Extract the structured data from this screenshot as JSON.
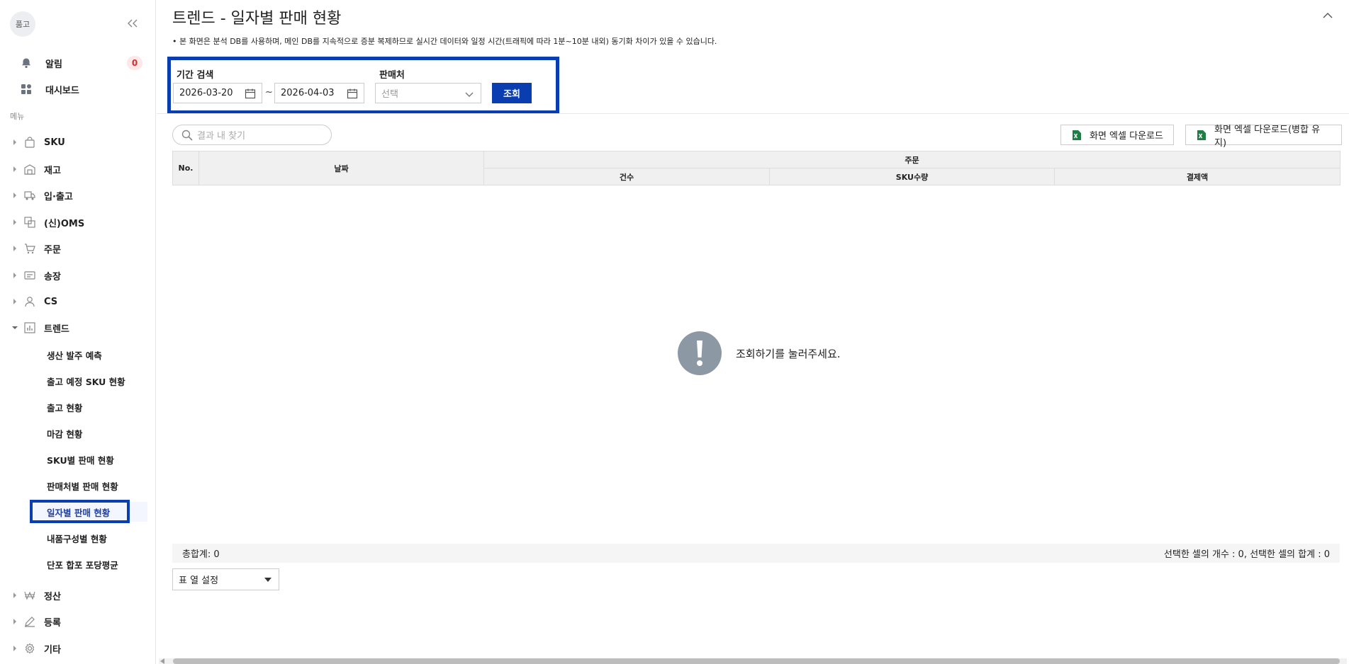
{
  "sidebar": {
    "logo": "품고",
    "alerts": {
      "label": "알림",
      "count": "0"
    },
    "dashboard": {
      "label": "대시보드"
    },
    "menu_caption": "메뉴",
    "items": [
      {
        "label": "SKU"
      },
      {
        "label": "재고"
      },
      {
        "label": "입·출고"
      },
      {
        "label": "(신)OMS"
      },
      {
        "label": "주문"
      },
      {
        "label": "송장"
      },
      {
        "label": "CS"
      },
      {
        "label": "트렌드"
      },
      {
        "label": "정산"
      },
      {
        "label": "등록"
      },
      {
        "label": "기타"
      }
    ],
    "trend_sub": [
      {
        "label": "생산 발주 예측"
      },
      {
        "label": "출고 예정 SKU 현황"
      },
      {
        "label": "출고 현황"
      },
      {
        "label": "마감 현황"
      },
      {
        "label": "SKU별 판매 현황"
      },
      {
        "label": "판매처별 판매 현황"
      },
      {
        "label": "일자별 판매 현황"
      },
      {
        "label": "내품구성별 현황"
      },
      {
        "label": "단포 합포 포당평균"
      }
    ]
  },
  "page": {
    "title": "트렌드 - 일자별 판매 현황",
    "notice": "• 본 화면은 분석 DB를 사용하며, 메인 DB를 지속적으로 증분 복제하므로 실시간 데이터와 일정 시간(트래픽에 따라 1분~10분 내외) 동기화 차이가 있을 수 있습니다."
  },
  "search": {
    "period_label": "기간 검색",
    "start_date": "2026-03-20",
    "tilde": "~",
    "end_date": "2026-04-03",
    "seller_label": "판매처",
    "seller_placeholder": "선택",
    "query_button": "조회"
  },
  "toolbar": {
    "result_search_placeholder": "결과 내 찾기",
    "excel_download": "화면 엑셀 다운로드",
    "excel_download_merge": "화면 엑셀 다운로드(병합 유지)"
  },
  "table": {
    "col_no": "No.",
    "col_date": "날짜",
    "group_order": "주문",
    "col_count": "건수",
    "col_sku_qty": "SKU수량",
    "col_payment": "결제액"
  },
  "empty_message": "조회하기를 눌러주세요.",
  "summary": {
    "total": "총합계: 0",
    "selection": "선택한 셀의 개수 : 0, 선택한 셀의 합계 : 0"
  },
  "column_setting": "표 열 설정",
  "colors": {
    "accent": "#0a3db0",
    "badge": "#d32f2f",
    "excel_green": "#1e7e45"
  }
}
